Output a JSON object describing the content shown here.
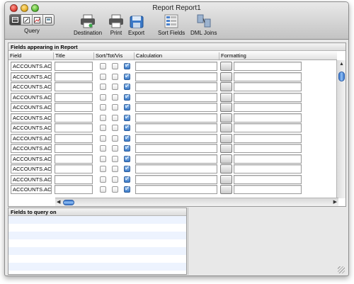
{
  "window": {
    "title": "Report Report1"
  },
  "toolbar": {
    "query_label": "Query",
    "destination_label": "Destination",
    "print_label": "Print",
    "export_label": "Export",
    "sort_fields_label": "Sort Fields",
    "dml_joins_label": "DML Joins"
  },
  "fields_panel": {
    "title": "Fields appearing in Report",
    "columns": [
      "Field",
      "Title",
      "Sort/Tot/Vis",
      "Calculation",
      "Formatting"
    ],
    "rows": [
      {
        "field": "ACCOUNTS.AC",
        "title": "",
        "sort": false,
        "tot": false,
        "vis": true,
        "calculation": "",
        "formatting": ""
      },
      {
        "field": "ACCOUNTS.AC",
        "title": "",
        "sort": false,
        "tot": false,
        "vis": true,
        "calculation": "",
        "formatting": ""
      },
      {
        "field": "ACCOUNTS.AC",
        "title": "",
        "sort": false,
        "tot": false,
        "vis": true,
        "calculation": "",
        "formatting": ""
      },
      {
        "field": "ACCOUNTS.AC",
        "title": "",
        "sort": false,
        "tot": false,
        "vis": true,
        "calculation": "",
        "formatting": ""
      },
      {
        "field": "ACCOUNTS.AC",
        "title": "",
        "sort": false,
        "tot": false,
        "vis": true,
        "calculation": "",
        "formatting": ""
      },
      {
        "field": "ACCOUNTS.AC",
        "title": "",
        "sort": false,
        "tot": false,
        "vis": true,
        "calculation": "",
        "formatting": ""
      },
      {
        "field": "ACCOUNTS.AC",
        "title": "",
        "sort": false,
        "tot": false,
        "vis": true,
        "calculation": "",
        "formatting": ""
      },
      {
        "field": "ACCOUNTS.AC",
        "title": "",
        "sort": false,
        "tot": false,
        "vis": true,
        "calculation": "",
        "formatting": ""
      },
      {
        "field": "ACCOUNTS.AC",
        "title": "",
        "sort": false,
        "tot": false,
        "vis": true,
        "calculation": "",
        "formatting": ""
      },
      {
        "field": "ACCOUNTS.AC",
        "title": "",
        "sort": false,
        "tot": false,
        "vis": true,
        "calculation": "",
        "formatting": ""
      },
      {
        "field": "ACCOUNTS.AC",
        "title": "",
        "sort": false,
        "tot": false,
        "vis": true,
        "calculation": "",
        "formatting": ""
      },
      {
        "field": "ACCOUNTS.AC",
        "title": "",
        "sort": false,
        "tot": false,
        "vis": true,
        "calculation": "",
        "formatting": ""
      },
      {
        "field": "ACCOUNTS.AC",
        "title": "",
        "sort": false,
        "tot": false,
        "vis": true,
        "calculation": "",
        "formatting": ""
      }
    ]
  },
  "query_panel": {
    "title": "Fields to query on"
  },
  "colors": {
    "accent": "#3979c8",
    "stripe": "#edf3fe"
  }
}
